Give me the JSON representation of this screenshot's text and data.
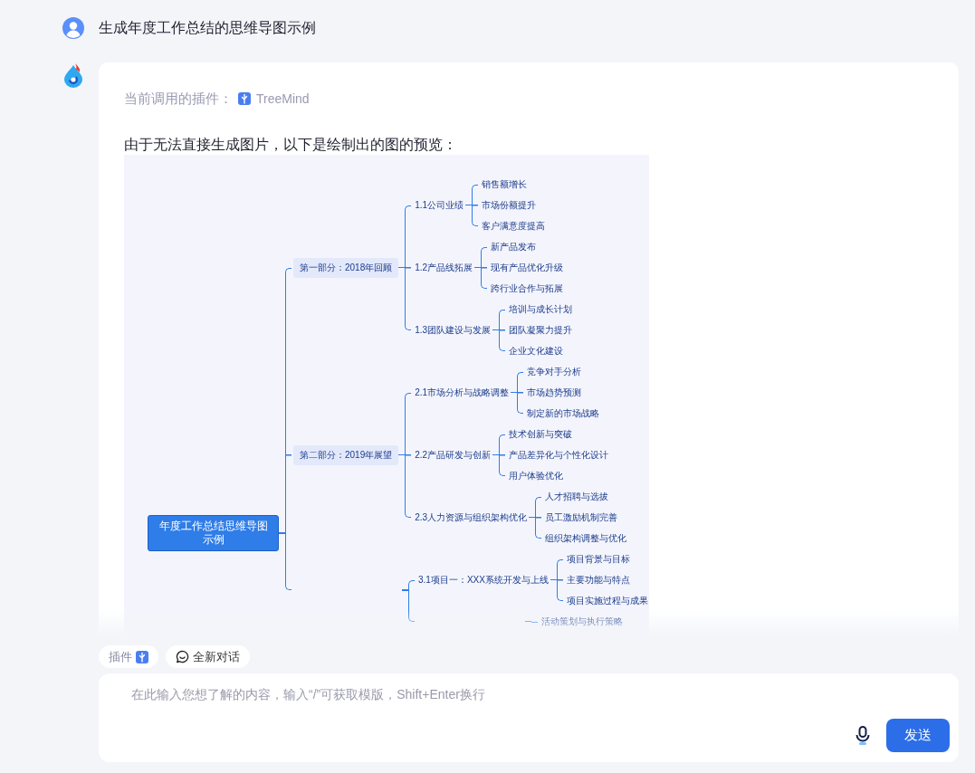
{
  "user_message": {
    "text": "生成年度工作总结的思维导图示例"
  },
  "assistant": {
    "plugin_label": "当前调用的插件：",
    "plugin_name": "TreeMind",
    "text": "由于无法直接生成图片，以下是绘制出的图的预览：",
    "mind_map": {
      "root": "年度工作总结思维导图示例",
      "children": [
        {
          "label": "第一部分：2018年回顾",
          "children": [
            {
              "label": "1.1公司业绩",
              "children": [
                {
                  "label": "销售额增长"
                },
                {
                  "label": "市场份额提升"
                },
                {
                  "label": "客户满意度提高"
                }
              ]
            },
            {
              "label": "1.2产品线拓展",
              "children": [
                {
                  "label": "新产品发布"
                },
                {
                  "label": "现有产品优化升级"
                },
                {
                  "label": "跨行业合作与拓展"
                }
              ]
            },
            {
              "label": "1.3团队建设与发展",
              "children": [
                {
                  "label": "培训与成长计划"
                },
                {
                  "label": "团队凝聚力提升"
                },
                {
                  "label": "企业文化建设"
                }
              ]
            }
          ]
        },
        {
          "label": "第二部分：2019年展望",
          "children": [
            {
              "label": "2.1市场分析与战略调整",
              "children": [
                {
                  "label": "竞争对手分析"
                },
                {
                  "label": "市场趋势预测"
                },
                {
                  "label": "制定新的市场战略"
                }
              ]
            },
            {
              "label": "2.2产品研发与创新",
              "children": [
                {
                  "label": "技术创新与突破"
                },
                {
                  "label": "产品差异化与个性化设计"
                },
                {
                  "label": "用户体验优化"
                }
              ]
            },
            {
              "label": "2.3人力资源与组织架构优化",
              "children": [
                {
                  "label": "人才招聘与选拔"
                },
                {
                  "label": "员工激励机制完善"
                },
                {
                  "label": "组织架构调整与优化"
                }
              ]
            }
          ]
        },
        {
          "children": [
            {
              "label": "3.1项目一：XXX系统开发与上线",
              "children": [
                {
                  "label": "项目背景与目标"
                },
                {
                  "label": "主要功能与特点"
                },
                {
                  "label": "项目实施过程与成果"
                }
              ]
            },
            {
              "children": [
                {
                  "label": "活动策划与执行策略"
                }
              ]
            }
          ]
        }
      ]
    }
  },
  "toolbar": {
    "plugin_chip": "插件",
    "new_chat": "全新对话"
  },
  "input": {
    "placeholder": "在此输入您想了解的内容，输入“/”可获取模版，Shift+Enter换行"
  },
  "send_button": "发送"
}
